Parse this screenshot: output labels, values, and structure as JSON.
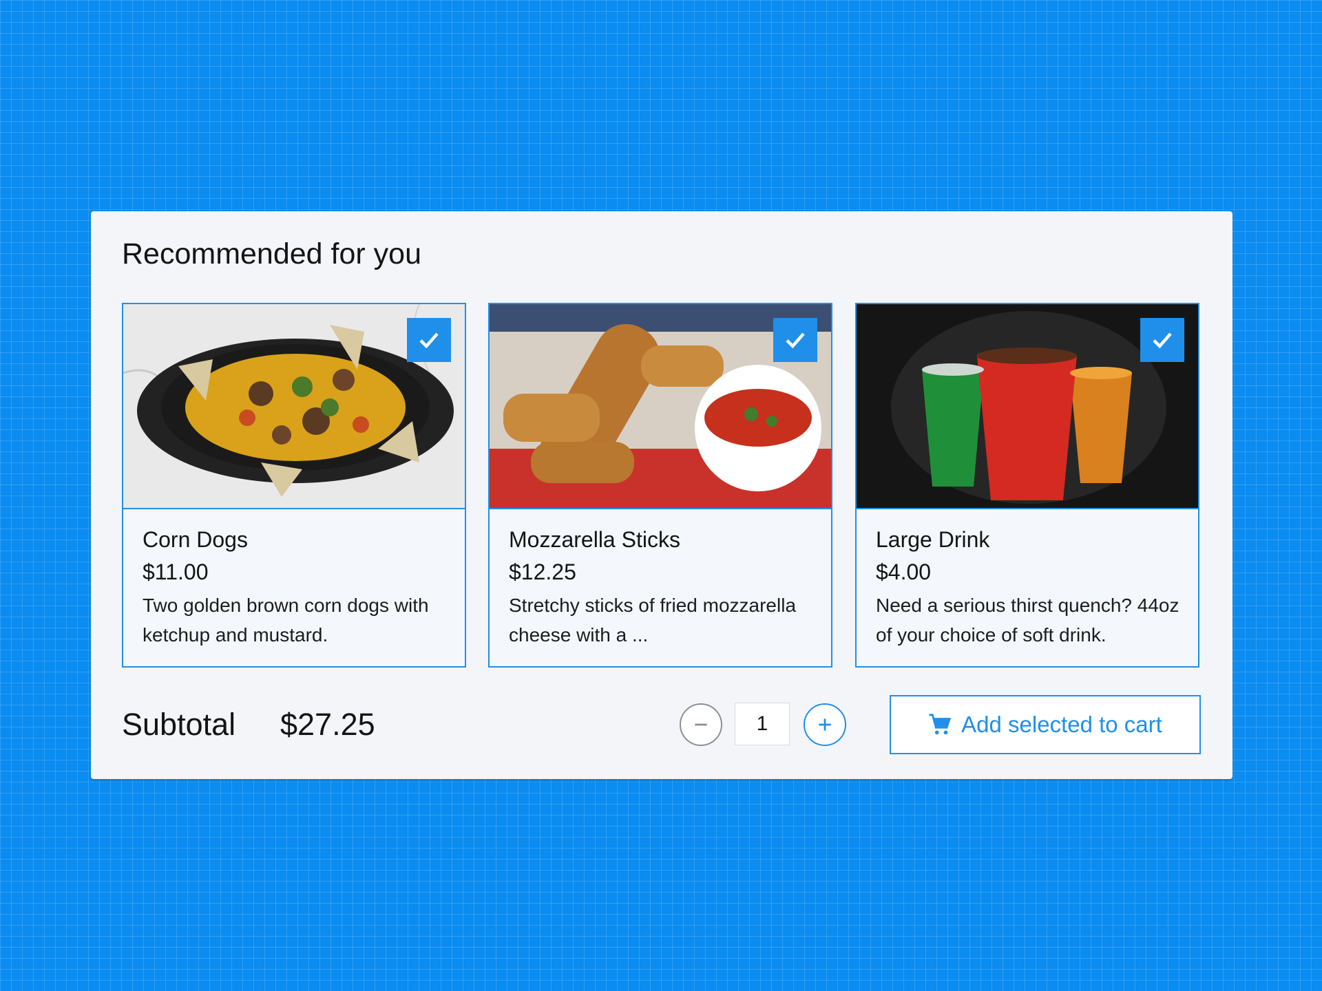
{
  "section": {
    "title": "Recommended for you"
  },
  "items": [
    {
      "name": "Corn Dogs",
      "price": "$11.00",
      "description": "Two golden brown corn dogs with ketchup and mustard.",
      "selected": true,
      "image": "nachos-in-cast-iron-pan"
    },
    {
      "name": "Mozzarella Sticks",
      "price": "$12.25",
      "description": "Stretchy sticks of fried mozzarella cheese with a ...",
      "selected": true,
      "image": "mozzarella-sticks-with-marinara"
    },
    {
      "name": "Large Drink",
      "price": "$4.00",
      "description": "Need a serious thirst quench? 44oz of your choice of soft drink.",
      "selected": true,
      "image": "three-soft-drink-cups"
    }
  ],
  "footer": {
    "subtotal_label": "Subtotal",
    "subtotal_value": "$27.25",
    "quantity": "1",
    "add_button_label": "Add selected to cart",
    "add_button_icon": "cart-icon"
  },
  "colors": {
    "accent": "#1f8fea",
    "background": "#0a8cf0",
    "panel": "#f3f5f9"
  }
}
